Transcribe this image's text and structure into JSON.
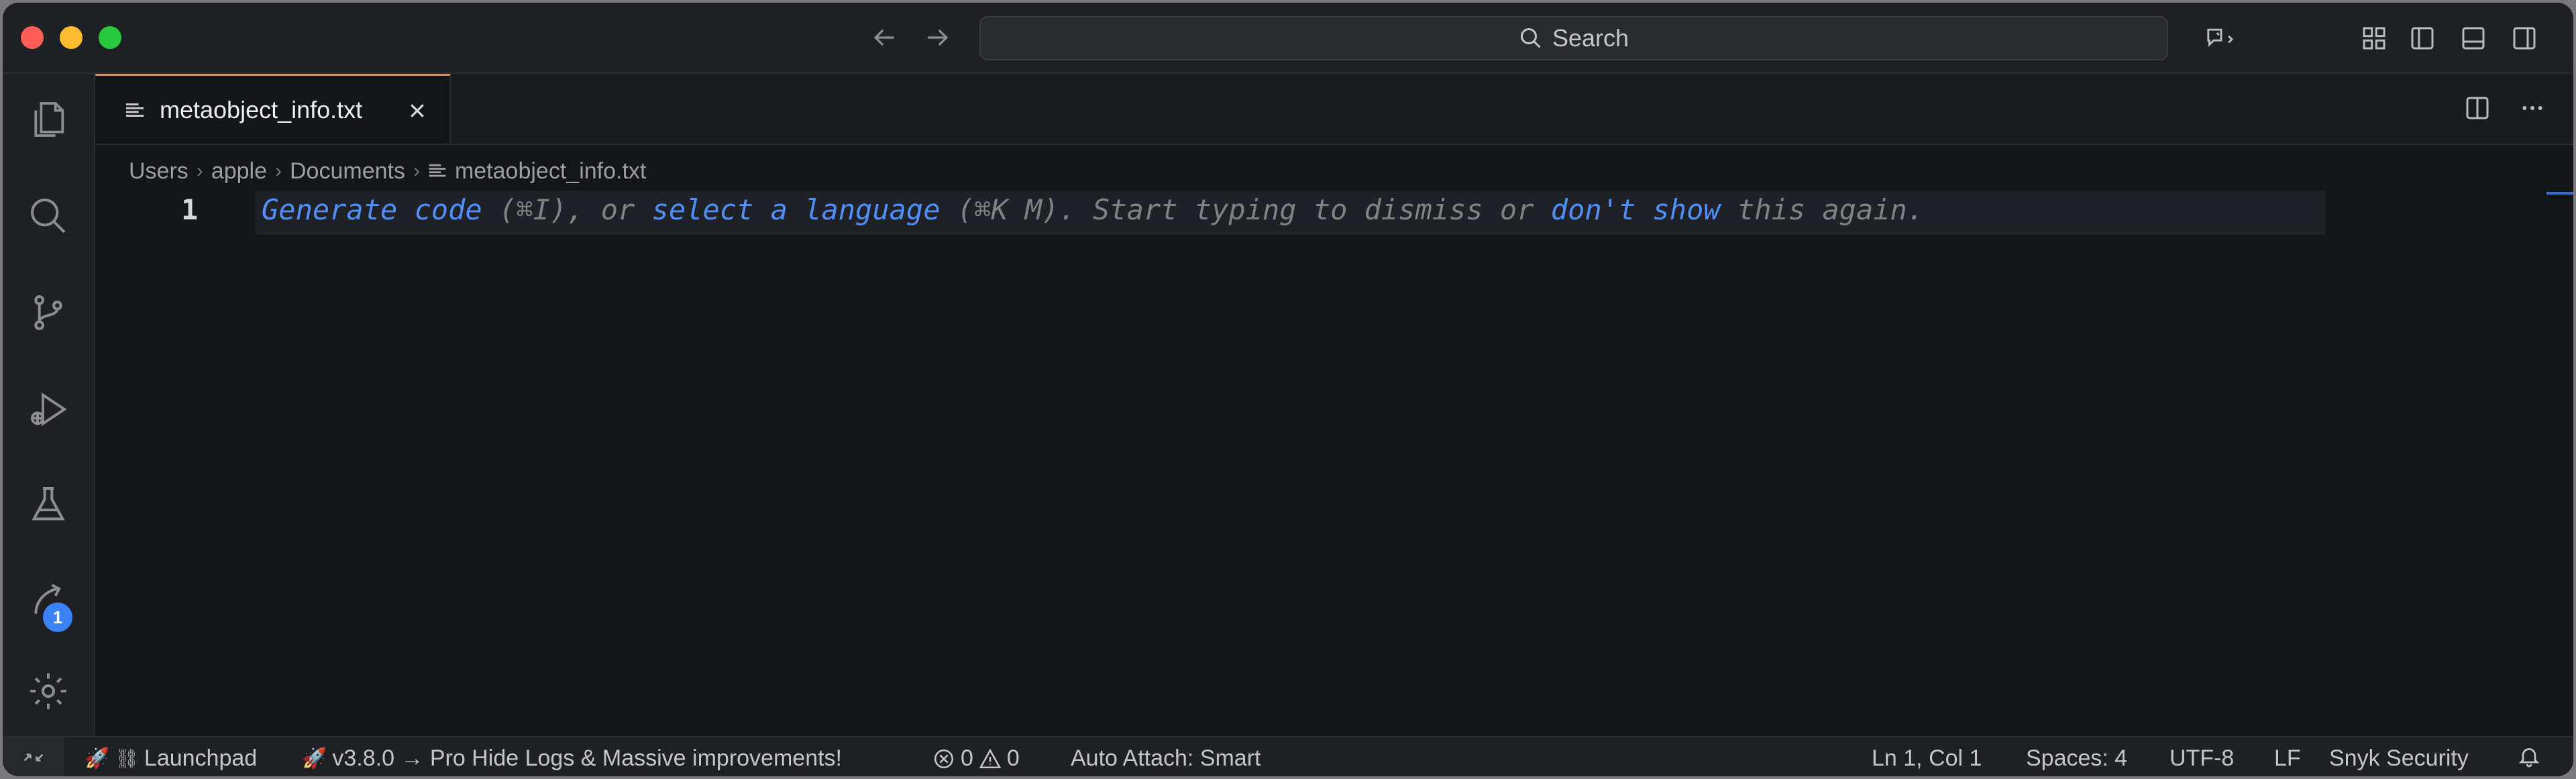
{
  "search": {
    "label": "Search"
  },
  "tab": {
    "filename": "metaobject_info.txt",
    "close_glyph": "✕"
  },
  "breadcrumb": {
    "items": [
      "Users",
      "apple",
      "Documents",
      "metaobject_info.txt"
    ]
  },
  "editor": {
    "line_number": "1",
    "hint": {
      "generate": "Generate code",
      "shortcut1": " (⌘I), or ",
      "select": "select a language",
      "shortcut2": " (⌘K M). Start typing to dismiss or ",
      "dontshow": "don't show",
      "tail": " this again."
    }
  },
  "activity": {
    "badge_count": "1"
  },
  "statusbar": {
    "launchpad": "Launchpad",
    "version_msg": "v3.8.0 → Pro Hide Logs & Massive improvements!",
    "errors": "0",
    "warnings": "0",
    "auto_attach": "Auto Attach: Smart",
    "position": "Ln 1, Col 1",
    "spaces": "Spaces: 4",
    "encoding": "UTF-8",
    "eol": "LF",
    "snyk": "Snyk Security"
  },
  "colors": {
    "accent_tab": "#d98b5f",
    "link": "#4f8ff7",
    "badge": "#3b82f6"
  }
}
